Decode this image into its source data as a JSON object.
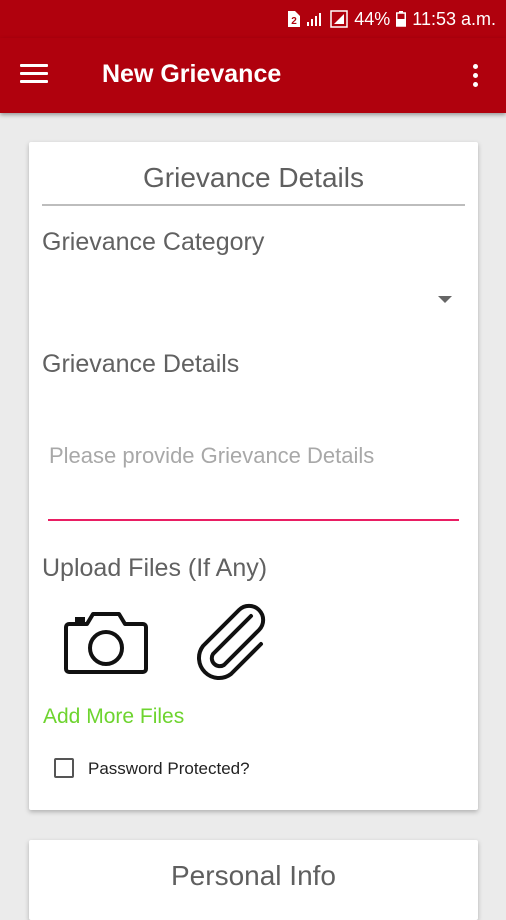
{
  "status_bar": {
    "battery": "44%",
    "time": "11:53 a.m.",
    "color": "#b0010d"
  },
  "app_bar": {
    "title": "New Grievance",
    "menu_icon": "menu-icon",
    "overflow_icon": "more-vert-icon"
  },
  "grievance_card": {
    "title": "Grievance Details",
    "category_label": "Grievance Category",
    "category_value": "",
    "details_label": "Grievance Details",
    "details_placeholder": "Please provide Grievance Details",
    "details_value": "",
    "upload_label": "Upload Files (If Any)",
    "camera_icon": "camera-icon",
    "attach_icon": "paperclip-icon",
    "add_more_label": "Add More Files",
    "password_label": "Password Protected?",
    "password_checked": false,
    "accent_color": "#e91e63",
    "link_color": "#6ed42f"
  },
  "personal_card": {
    "title": "Personal Info"
  }
}
